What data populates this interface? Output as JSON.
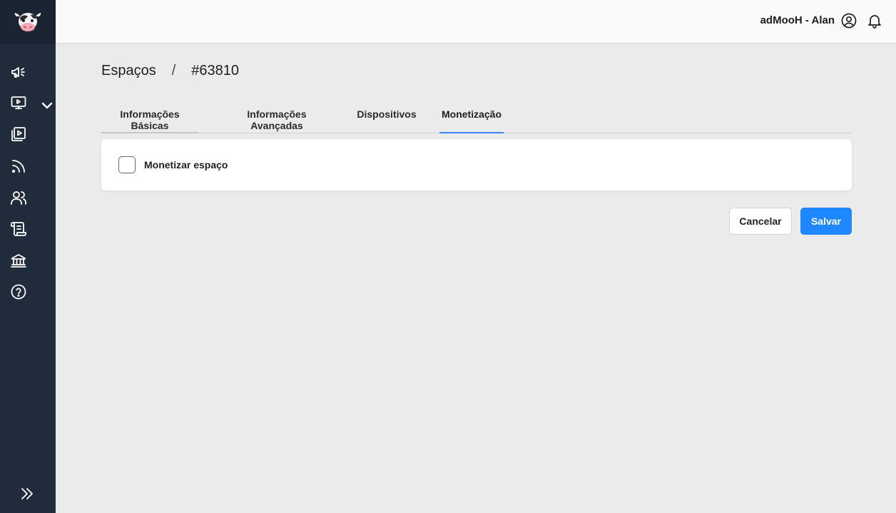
{
  "header": {
    "user_label": "adMooH - Alan"
  },
  "breadcrumb": {
    "section": "Espaços",
    "separator": "/",
    "current": "#63810"
  },
  "tabs": [
    {
      "label": "Informações Básicas"
    },
    {
      "label": "Informações Avançadas"
    },
    {
      "label": "Dispositivos"
    },
    {
      "label": "Monetização"
    }
  ],
  "active_tab": "Monetização",
  "monetization": {
    "checkbox_label": "Monetizar espaço",
    "checked": false
  },
  "actions": {
    "cancel_label": "Cancelar",
    "save_label": "Salvar"
  },
  "sidebar": {
    "items": [
      {
        "icon": "megaphone-icon"
      },
      {
        "icon": "monitor-play-icon",
        "has_submenu": true
      },
      {
        "icon": "media-library-icon"
      },
      {
        "icon": "rss-icon"
      },
      {
        "icon": "users-icon"
      },
      {
        "icon": "scroll-icon"
      },
      {
        "icon": "bank-icon"
      },
      {
        "icon": "help-icon"
      }
    ]
  },
  "colors": {
    "sidebar_bg": "#202b3c",
    "accent": "#1f87ff",
    "active_tab_underline": "#3b82f6"
  }
}
